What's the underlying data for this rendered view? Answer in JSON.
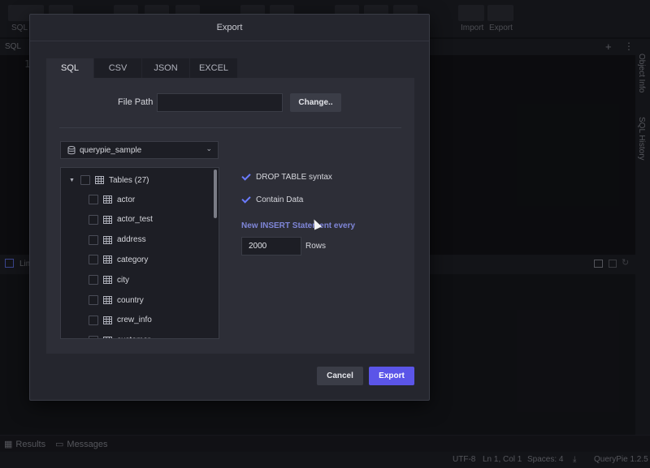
{
  "background": {
    "toolbar": {
      "sql_label": "SQL",
      "import_label": "Import",
      "export_label": "Export"
    },
    "editor_tab": "SQL",
    "line_number": "1",
    "results_toggle_label": "Lim",
    "right_rail": [
      "Object Info",
      "SQL History"
    ],
    "bottom_tabs": [
      "Results",
      "Messages"
    ],
    "status": {
      "encoding": "UTF-8",
      "position": "Ln 1, Col 1",
      "spaces": "Spaces: 4",
      "version": "QueryPie 1.2.5"
    }
  },
  "dialog": {
    "title": "Export",
    "tabs": [
      "SQL",
      "CSV",
      "JSON",
      "EXCEL"
    ],
    "active_tab": "SQL",
    "file_path_label": "File Path",
    "file_path_value": "",
    "change_button": "Change..",
    "database": "querypie_sample",
    "tree": {
      "root_label": "Tables (27)",
      "items": [
        "actor",
        "actor_test",
        "address",
        "category",
        "city",
        "country",
        "crew_info",
        "customer"
      ]
    },
    "options": {
      "drop_table_label": "DROP TABLE syntax",
      "drop_table_checked": true,
      "contain_data_label": "Contain Data",
      "contain_data_checked": true
    },
    "insert_label": "New INSERT Statement every",
    "rows_value": "2000",
    "rows_label": "Rows",
    "cancel_button": "Cancel",
    "export_button": "Export"
  },
  "colors": {
    "accent": "#5b55e8",
    "link": "#7f86d8",
    "check": "#6b7cff"
  }
}
